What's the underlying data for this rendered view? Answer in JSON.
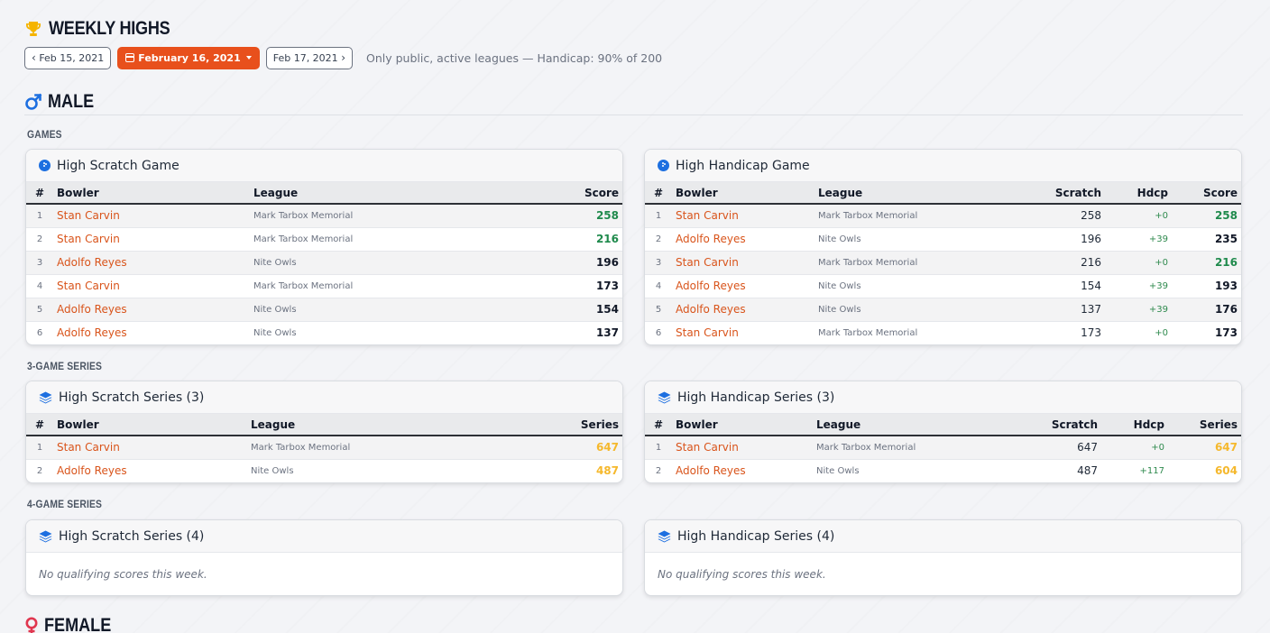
{
  "page": {
    "title": "WEEKLY HIGHS",
    "prev_date": "Feb 15, 2021",
    "current_date": "February 16, 2021",
    "next_date": "Feb 17, 2021",
    "note": "Only public, active leagues — Handicap: 90% of 200"
  },
  "colors": {
    "accent": "#e8501c",
    "bowler": "#d9541b",
    "male": "#1d6fe0",
    "female": "#e0364f",
    "top_score": "#1f8a4c",
    "series_gold": "#f5b82c"
  },
  "male": {
    "title": "MALE",
    "games_label": "GAMES",
    "series3_label": "3-GAME SERIES",
    "series4_label": "4-GAME SERIES",
    "high_scratch_game": {
      "title": "High Scratch Game",
      "headers": [
        "#",
        "Bowler",
        "League",
        "Score"
      ],
      "rows": [
        {
          "rank": "1",
          "bowler": "Stan Carvin",
          "league": "Mark Tarbox Memorial",
          "score": "258"
        },
        {
          "rank": "2",
          "bowler": "Stan Carvin",
          "league": "Mark Tarbox Memorial",
          "score": "216"
        },
        {
          "rank": "3",
          "bowler": "Adolfo Reyes",
          "league": "Nite Owls",
          "score": "196"
        },
        {
          "rank": "4",
          "bowler": "Stan Carvin",
          "league": "Mark Tarbox Memorial",
          "score": "173"
        },
        {
          "rank": "5",
          "bowler": "Adolfo Reyes",
          "league": "Nite Owls",
          "score": "154"
        },
        {
          "rank": "6",
          "bowler": "Adolfo Reyes",
          "league": "Nite Owls",
          "score": "137"
        }
      ]
    },
    "high_handicap_game": {
      "title": "High Handicap Game",
      "headers": [
        "#",
        "Bowler",
        "League",
        "Scratch",
        "Hdcp",
        "Score"
      ],
      "rows": [
        {
          "rank": "1",
          "bowler": "Stan Carvin",
          "league": "Mark Tarbox Memorial",
          "scratch": "258",
          "hdcp": "+0",
          "score": "258"
        },
        {
          "rank": "2",
          "bowler": "Adolfo Reyes",
          "league": "Nite Owls",
          "scratch": "196",
          "hdcp": "+39",
          "score": "235"
        },
        {
          "rank": "3",
          "bowler": "Stan Carvin",
          "league": "Mark Tarbox Memorial",
          "scratch": "216",
          "hdcp": "+0",
          "score": "216"
        },
        {
          "rank": "4",
          "bowler": "Adolfo Reyes",
          "league": "Nite Owls",
          "scratch": "154",
          "hdcp": "+39",
          "score": "193"
        },
        {
          "rank": "5",
          "bowler": "Adolfo Reyes",
          "league": "Nite Owls",
          "scratch": "137",
          "hdcp": "+39",
          "score": "176"
        },
        {
          "rank": "6",
          "bowler": "Stan Carvin",
          "league": "Mark Tarbox Memorial",
          "scratch": "173",
          "hdcp": "+0",
          "score": "173"
        }
      ]
    },
    "high_scratch_series3": {
      "title": "High Scratch Series (3)",
      "headers": [
        "#",
        "Bowler",
        "League",
        "Series"
      ],
      "rows": [
        {
          "rank": "1",
          "bowler": "Stan Carvin",
          "league": "Mark Tarbox Memorial",
          "series": "647"
        },
        {
          "rank": "2",
          "bowler": "Adolfo Reyes",
          "league": "Nite Owls",
          "series": "487"
        }
      ]
    },
    "high_handicap_series3": {
      "title": "High Handicap Series (3)",
      "headers": [
        "#",
        "Bowler",
        "League",
        "Scratch",
        "Hdcp",
        "Series"
      ],
      "rows": [
        {
          "rank": "1",
          "bowler": "Stan Carvin",
          "league": "Mark Tarbox Memorial",
          "scratch": "647",
          "hdcp": "+0",
          "series": "647"
        },
        {
          "rank": "2",
          "bowler": "Adolfo Reyes",
          "league": "Nite Owls",
          "scratch": "487",
          "hdcp": "+117",
          "series": "604"
        }
      ]
    },
    "high_scratch_series4": {
      "title": "High Scratch Series (4)",
      "empty": "No qualifying scores this week."
    },
    "high_handicap_series4": {
      "title": "High Handicap Series (4)",
      "empty": "No qualifying scores this week."
    }
  },
  "female": {
    "title": "FEMALE"
  }
}
